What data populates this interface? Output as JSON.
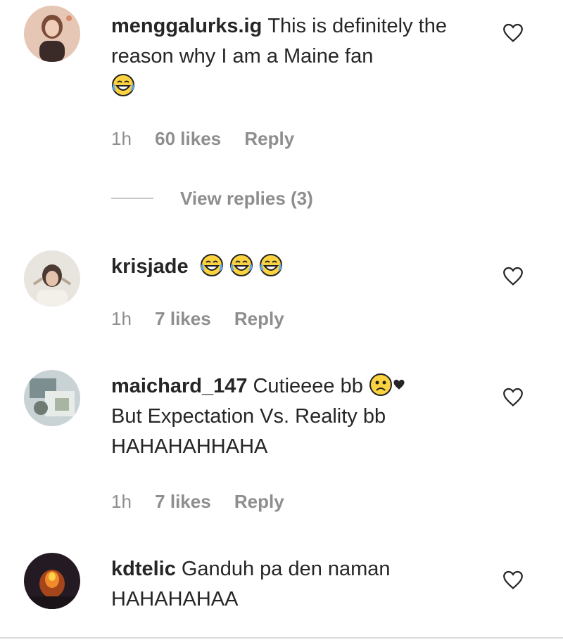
{
  "comments": [
    {
      "username": "menggalurks.ig",
      "text": "This is definitely the reason why I am a Maine fan",
      "emojis": [
        "face-with-tears-of-joy"
      ],
      "time": "1h",
      "likes": "60 likes",
      "reply": "Reply",
      "view_replies": "View replies (3)"
    },
    {
      "username": "krisjade",
      "text": "",
      "emojis": [
        "face-with-tears-of-joy",
        "face-with-tears-of-joy",
        "face-with-tears-of-joy"
      ],
      "time": "1h",
      "likes": "7 likes",
      "reply": "Reply"
    },
    {
      "username": "maichard_147",
      "text_a": "Cutieeee bb",
      "text_b": "But Expectation Vs. Reality bb HAHAHAHHAHA",
      "emojis": [
        "sad-face",
        "black-heart"
      ],
      "time": "1h",
      "likes": "7 likes",
      "reply": "Reply"
    },
    {
      "username": "kdtelic",
      "text": "Ganduh pa den naman HAHAHAHAA"
    }
  ],
  "icons": {
    "like": "heart-outline-icon"
  },
  "colors": {
    "primary_text": "#262626",
    "secondary_text": "#8e8e8e",
    "divider": "#dbdbdb"
  }
}
